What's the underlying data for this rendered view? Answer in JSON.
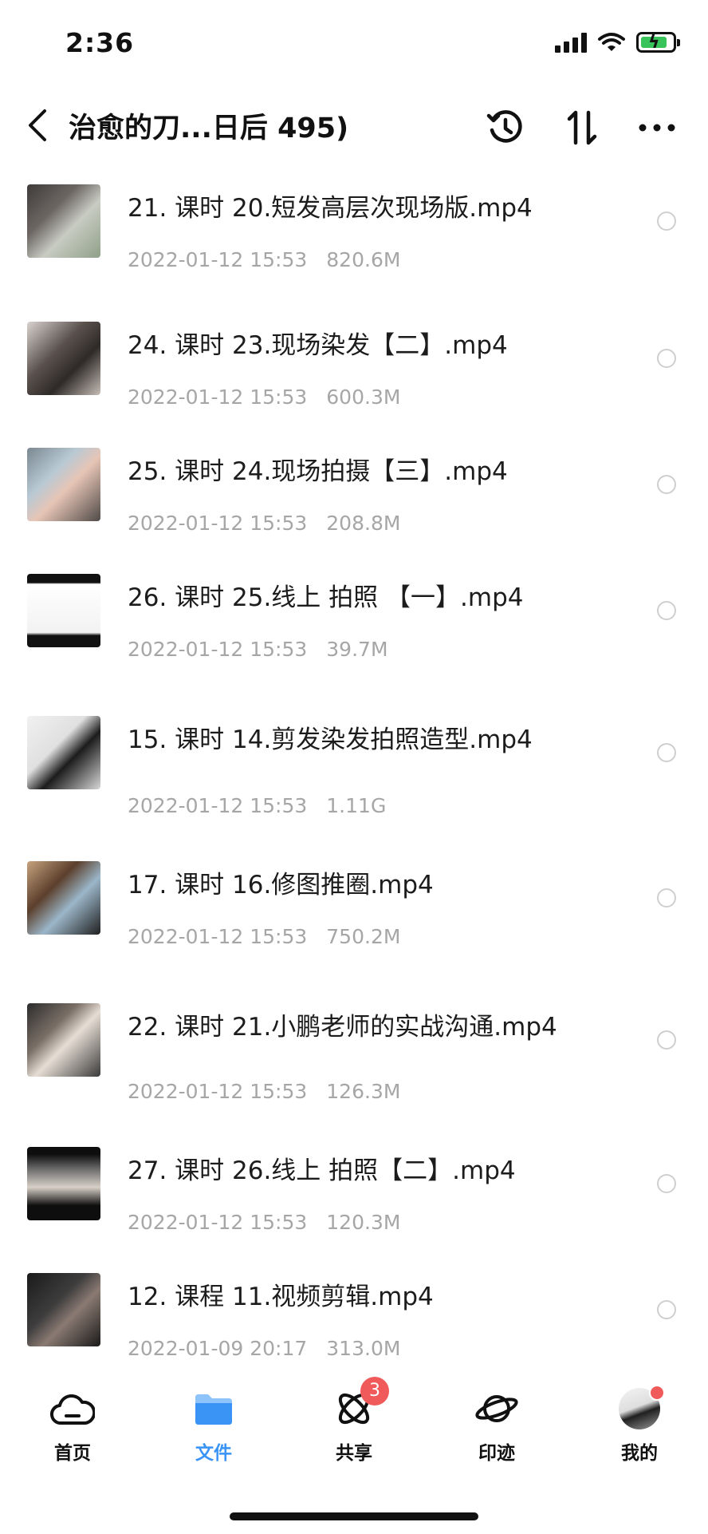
{
  "status_bar": {
    "time": "2:36"
  },
  "header": {
    "title": "治愈的刀...日后 495)"
  },
  "files": [
    {
      "name": "21. 课时 20.短发高层次现场版.mp4",
      "date": "2022-01-12 15:53",
      "size": "820.6M"
    },
    {
      "name": "24. 课时 23.现场染发【二】.mp4",
      "date": "2022-01-12 15:53",
      "size": "600.3M"
    },
    {
      "name": "25. 课时 24.现场拍摄【三】.mp4",
      "date": "2022-01-12 15:53",
      "size": "208.8M"
    },
    {
      "name": "26. 课时 25.线上 拍照 【一】.mp4",
      "date": "2022-01-12 15:53",
      "size": "39.7M"
    },
    {
      "name": "15. 课时 14.剪发染发拍照造型.mp4",
      "date": "2022-01-12 15:53",
      "size": "1.11G"
    },
    {
      "name": "17. 课时 16.修图推圈.mp4",
      "date": "2022-01-12 15:53",
      "size": "750.2M"
    },
    {
      "name": "22. 课时 21.小鹏老师的实战沟通.mp4",
      "date": "2022-01-12 15:53",
      "size": "126.3M"
    },
    {
      "name": "27. 课时 26.线上 拍照【二】.mp4",
      "date": "2022-01-12 15:53",
      "size": "120.3M"
    },
    {
      "name": "12. 课程 11.视频剪辑.mp4",
      "date": "2022-01-09 20:17",
      "size": "313.0M"
    }
  ],
  "tabs": [
    {
      "label": "首页",
      "icon": "cloud-icon"
    },
    {
      "label": "文件",
      "icon": "folder-icon",
      "active": true
    },
    {
      "label": "共享",
      "icon": "share-orbit-icon",
      "badge": "3"
    },
    {
      "label": "印迹",
      "icon": "planet-icon"
    },
    {
      "label": "我的",
      "icon": "avatar"
    }
  ],
  "colors": {
    "accent": "#3a94f6",
    "badge": "#f05a5a",
    "meta_text": "#a6a6a6"
  }
}
